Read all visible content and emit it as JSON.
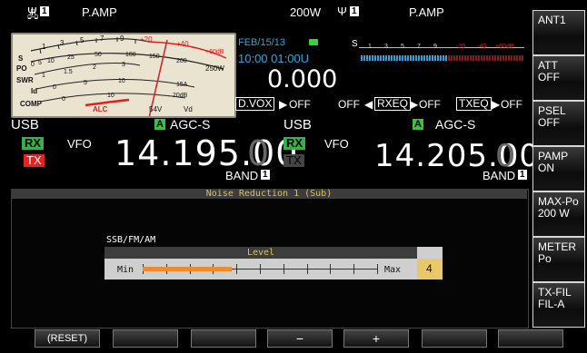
{
  "top": {
    "left_ant_tag": "1",
    "left_mode": "P.AMP",
    "power": "200W",
    "right_ant_tag": "1",
    "right_mode": "P.AMP"
  },
  "meter": {
    "s_scale": [
      "S",
      "1",
      "3",
      "5",
      "7",
      "9",
      "+20",
      "+40",
      "+60dB"
    ],
    "po_scale": [
      "PO",
      "0",
      "5",
      "10",
      "25",
      "50",
      "100",
      "150",
      "200",
      "250W"
    ],
    "swr_scale": [
      "SWR",
      "1",
      "1.5",
      "2",
      "3"
    ],
    "id_scale": [
      "Id",
      "0",
      "5",
      "10",
      "15A"
    ],
    "comp_scale": [
      "COMP",
      "0",
      "10",
      "20dB"
    ],
    "alc_label": "ALC",
    "vd_scale": [
      "54V",
      "Vd"
    ]
  },
  "datetime": {
    "date": "FEB/15/13",
    "time": "10:00 01:00U",
    "counter": "0.000"
  },
  "bargraph": {
    "s_scale": [
      "S",
      "1",
      "3",
      "5",
      "7",
      "9",
      "-20",
      "-40",
      "+60dB"
    ],
    "blue_level": 0.55
  },
  "func": {
    "dvox_label": "D.VOX",
    "dvox_value": "OFF",
    "off_label": "OFF",
    "rxeq_label": "RXEQ",
    "rxeq_value": "OFF",
    "txeq_label": "TXEQ",
    "txeq_value": "OFF"
  },
  "main_vfo": {
    "mode": "USB",
    "agc": "AGC-S",
    "agc_tag": "A",
    "rx": "RX",
    "tx": "TX",
    "vfo": "VFO",
    "freq": "14.195.00",
    "freq_last": "0",
    "band": "BAND",
    "band_num": "1"
  },
  "sub_vfo": {
    "mode": "USB",
    "agc": "AGC-S",
    "agc_tag": "A",
    "rx": "RX",
    "tx": "TX",
    "vfo": "VFO",
    "freq": "14.205.00",
    "freq_last": "0",
    "band": "BAND",
    "band_num": "1"
  },
  "panel": {
    "title": "Noise Reduction 1 (Sub)",
    "group_label": "SSB/FM/AM",
    "level_label": "Level",
    "min_label": "Min",
    "max_label": "Max",
    "value": "4",
    "level_fraction": 0.38
  },
  "soft_keys": [
    {
      "line1": "ANT1",
      "line2": ""
    },
    {
      "line1": "ATT",
      "line2": "OFF"
    },
    {
      "line1": "PSEL",
      "line2": "OFF"
    },
    {
      "line1": "PAMP",
      "line2": "ON"
    },
    {
      "line1": "MAX-Po",
      "line2": "200 W"
    },
    {
      "line1": "METER",
      "line2": "Po"
    },
    {
      "line1": "TX-FIL",
      "line2": "FIL-A"
    }
  ],
  "bottom_keys": [
    "(RESET)",
    "",
    "",
    "−",
    "+",
    "",
    ""
  ],
  "colors": {
    "accent_blue": "#2aa7e0",
    "rx_green": "#36b14a",
    "tx_red": "#e8211f",
    "panel_title": "#d9c25a",
    "value_box": "#e8c86a"
  }
}
